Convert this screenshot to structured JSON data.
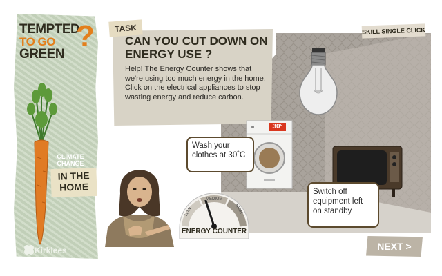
{
  "brand": {
    "line1": "TEMPTED",
    "line2": "TO GO",
    "line3": "GREEN",
    "mark": "?"
  },
  "side": {
    "climate_change": "CLIMATE CHANGE",
    "section": "IN THE HOME",
    "logo": "Kirklees"
  },
  "task": {
    "tab_label": "TASK",
    "title": "CAN YOU CUT DOWN ON ENERGY USE ?",
    "body": "Help! The Energy Counter shows that we're using too much energy in the home. Click on the electrical appliances to stop wasting energy and reduce carbon."
  },
  "skill": {
    "label": "SKILL",
    "value": "SINGLE CLICK"
  },
  "washer": {
    "display": "30°"
  },
  "callouts": {
    "wash": "Wash your clothes at 30˚C",
    "standby": "Switch off equipment left on standby"
  },
  "gauge": {
    "low": "LOW",
    "medium": "MEDIUM",
    "high": "HIGH",
    "title": "ENERGY COUNTER",
    "level_fraction": 0.4
  },
  "nav": {
    "next": "NEXT >"
  },
  "colors": {
    "accent": "#e37f1c",
    "dark": "#2f2c1f",
    "paper": "#d8d3c6",
    "washer_display": "#d9371f"
  }
}
